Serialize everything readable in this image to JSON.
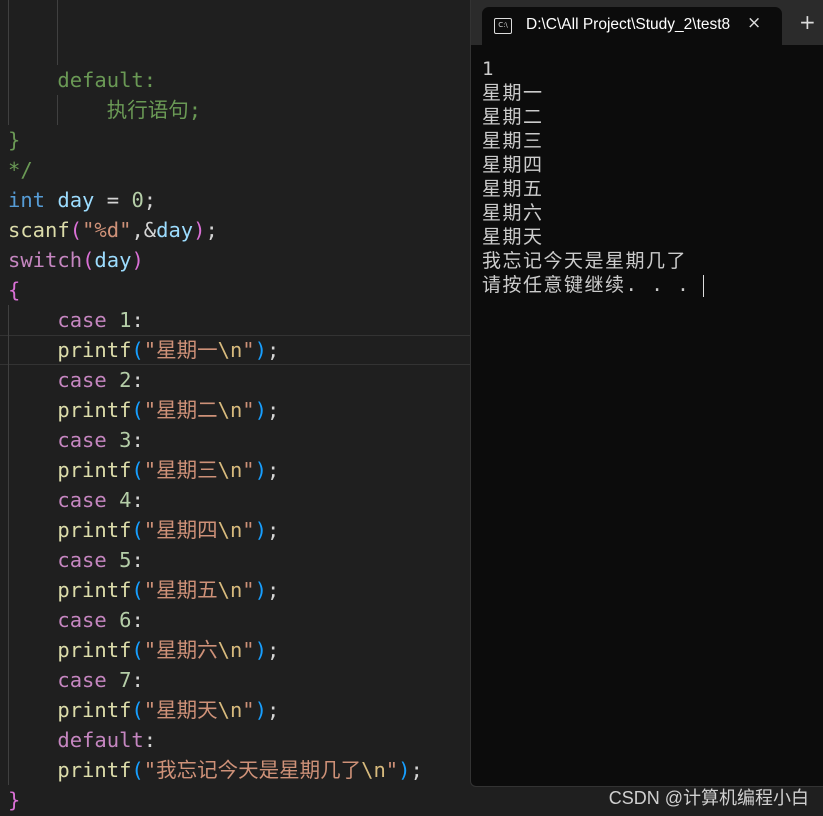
{
  "colors": {
    "keyword": "#c586c0",
    "function": "#dcdcaa",
    "string": "#ce9178",
    "escape": "#d7ba7d",
    "variable": "#9cdcfe",
    "type": "#569cd6",
    "number": "#b5cea8",
    "comment": "#6a9955",
    "plain": "#d4d4d4",
    "paren1": "#da70d6",
    "paren2": "#179fff",
    "brace": "#da70d6"
  },
  "editor": {
    "highlighted_line": 11,
    "lines": [
      [],
      [],
      [
        [
          "    default:",
          "comment"
        ]
      ],
      [
        [
          "        执行语句;",
          "comment"
        ]
      ],
      [
        [
          "}",
          "comment"
        ]
      ],
      [
        [
          "*/",
          "comment"
        ]
      ],
      [
        [
          "int",
          "type"
        ],
        [
          " ",
          "plain"
        ],
        [
          "day",
          "variable"
        ],
        [
          " = ",
          "plain"
        ],
        [
          "0",
          "number"
        ],
        [
          ";",
          "plain"
        ]
      ],
      [
        [
          "scanf",
          "function"
        ],
        [
          "(",
          "paren1"
        ],
        [
          "\"%d\"",
          "string"
        ],
        [
          ",&",
          "plain"
        ],
        [
          "day",
          "variable"
        ],
        [
          ")",
          "paren1"
        ],
        [
          ";",
          "plain"
        ]
      ],
      [
        [
          "switch",
          "keyword"
        ],
        [
          "(",
          "paren1"
        ],
        [
          "day",
          "variable"
        ],
        [
          ")",
          "paren1"
        ]
      ],
      [
        [
          "{",
          "brace"
        ]
      ],
      [
        [
          "    case ",
          "keyword"
        ],
        [
          "1",
          "number"
        ],
        [
          ":",
          "plain"
        ]
      ],
      [
        [
          "    printf",
          "function"
        ],
        [
          "(",
          "paren2"
        ],
        [
          "\"星期一",
          "string"
        ],
        [
          "\\n",
          "escape"
        ],
        [
          "\"",
          "string"
        ],
        [
          ")",
          "paren2"
        ],
        [
          ";",
          "plain"
        ]
      ],
      [
        [
          "    case ",
          "keyword"
        ],
        [
          "2",
          "number"
        ],
        [
          ":",
          "plain"
        ]
      ],
      [
        [
          "    printf",
          "function"
        ],
        [
          "(",
          "paren2"
        ],
        [
          "\"星期二",
          "string"
        ],
        [
          "\\n",
          "escape"
        ],
        [
          "\"",
          "string"
        ],
        [
          ")",
          "paren2"
        ],
        [
          ";",
          "plain"
        ]
      ],
      [
        [
          "    case ",
          "keyword"
        ],
        [
          "3",
          "number"
        ],
        [
          ":",
          "plain"
        ]
      ],
      [
        [
          "    printf",
          "function"
        ],
        [
          "(",
          "paren2"
        ],
        [
          "\"星期三",
          "string"
        ],
        [
          "\\n",
          "escape"
        ],
        [
          "\"",
          "string"
        ],
        [
          ")",
          "paren2"
        ],
        [
          ";",
          "plain"
        ]
      ],
      [
        [
          "    case ",
          "keyword"
        ],
        [
          "4",
          "number"
        ],
        [
          ":",
          "plain"
        ]
      ],
      [
        [
          "    printf",
          "function"
        ],
        [
          "(",
          "paren2"
        ],
        [
          "\"星期四",
          "string"
        ],
        [
          "\\n",
          "escape"
        ],
        [
          "\"",
          "string"
        ],
        [
          ")",
          "paren2"
        ],
        [
          ";",
          "plain"
        ]
      ],
      [
        [
          "    case ",
          "keyword"
        ],
        [
          "5",
          "number"
        ],
        [
          ":",
          "plain"
        ]
      ],
      [
        [
          "    printf",
          "function"
        ],
        [
          "(",
          "paren2"
        ],
        [
          "\"星期五",
          "string"
        ],
        [
          "\\n",
          "escape"
        ],
        [
          "\"",
          "string"
        ],
        [
          ")",
          "paren2"
        ],
        [
          ";",
          "plain"
        ]
      ],
      [
        [
          "    case ",
          "keyword"
        ],
        [
          "6",
          "number"
        ],
        [
          ":",
          "plain"
        ]
      ],
      [
        [
          "    printf",
          "function"
        ],
        [
          "(",
          "paren2"
        ],
        [
          "\"星期六",
          "string"
        ],
        [
          "\\n",
          "escape"
        ],
        [
          "\"",
          "string"
        ],
        [
          ")",
          "paren2"
        ],
        [
          ";",
          "plain"
        ]
      ],
      [
        [
          "    case ",
          "keyword"
        ],
        [
          "7",
          "number"
        ],
        [
          ":",
          "plain"
        ]
      ],
      [
        [
          "    printf",
          "function"
        ],
        [
          "(",
          "paren2"
        ],
        [
          "\"星期天",
          "string"
        ],
        [
          "\\n",
          "escape"
        ],
        [
          "\"",
          "string"
        ],
        [
          ")",
          "paren2"
        ],
        [
          ";",
          "plain"
        ]
      ],
      [
        [
          "    default",
          "keyword"
        ],
        [
          ":",
          "plain"
        ]
      ],
      [
        [
          "    printf",
          "function"
        ],
        [
          "(",
          "paren2"
        ],
        [
          "\"我忘记今天是星期几了",
          "string"
        ],
        [
          "\\n",
          "escape"
        ],
        [
          "\"",
          "string"
        ],
        [
          ")",
          "paren2"
        ],
        [
          ";",
          "plain"
        ]
      ],
      [
        [
          "}",
          "brace"
        ]
      ]
    ]
  },
  "terminal": {
    "tab_title": "D:\\C\\All Project\\Study_2\\test8",
    "tab_icon": "console-icon",
    "close_icon": "×",
    "new_tab_icon": "+",
    "output": [
      "1",
      "星期一",
      "星期二",
      "星期三",
      "星期四",
      "星期五",
      "星期六",
      "星期天",
      "我忘记今天是星期几了",
      "请按任意键继续. . . "
    ]
  },
  "watermark": "CSDN @计算机编程小白"
}
